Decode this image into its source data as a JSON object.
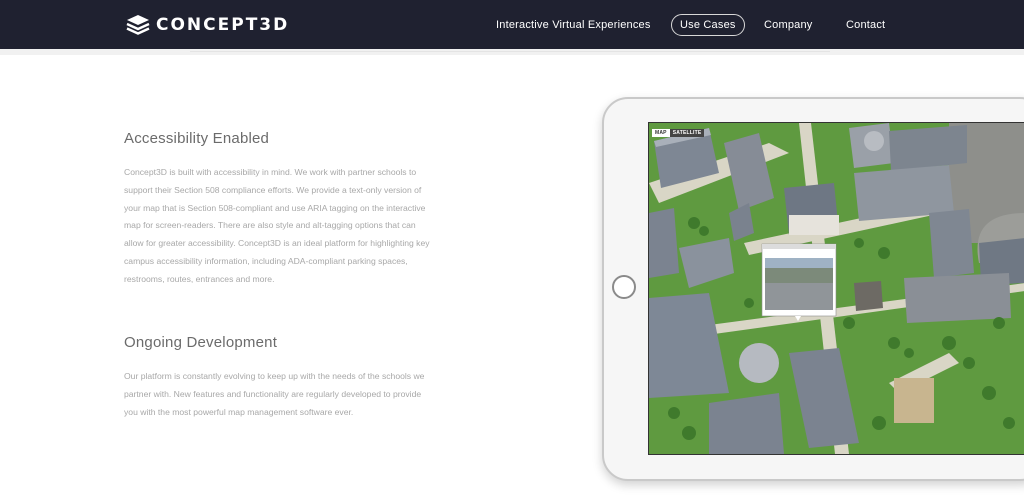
{
  "brand": {
    "name": "CONCEPT3D"
  },
  "nav": {
    "items": [
      "Interactive Virtual Experiences",
      "Use Cases",
      "Company",
      "Contact"
    ],
    "active": "Use Cases"
  },
  "sections": [
    {
      "title": "Accessibility Enabled",
      "body": "Concept3D is built with accessibility in mind. We work with partner schools to support their Section 508 compliance efforts. We provide a text-only version of your map that is Section 508-compliant and use ARIA tagging on the interactive map for screen-readers. There are also style and alt-tagging options that can allow for greater accessibility. Concept3D is an ideal platform for highlighting key campus accessibility information, including ADA-compliant parking spaces, restrooms, routes, entrances and more."
    },
    {
      "title": "Ongoing Development",
      "body": "Our platform is constantly evolving to keep up with the needs of the schools we partner with. New features and functionality are regularly developed to provide you with the most powerful map management software ever."
    }
  ],
  "map": {
    "toggle": [
      "MAP",
      "SATELLITE"
    ]
  },
  "colors": {
    "header": "#1f2130",
    "grass": "#5f9a40",
    "heading": "#6b6b6b",
    "body_text": "#a8a8a8"
  }
}
